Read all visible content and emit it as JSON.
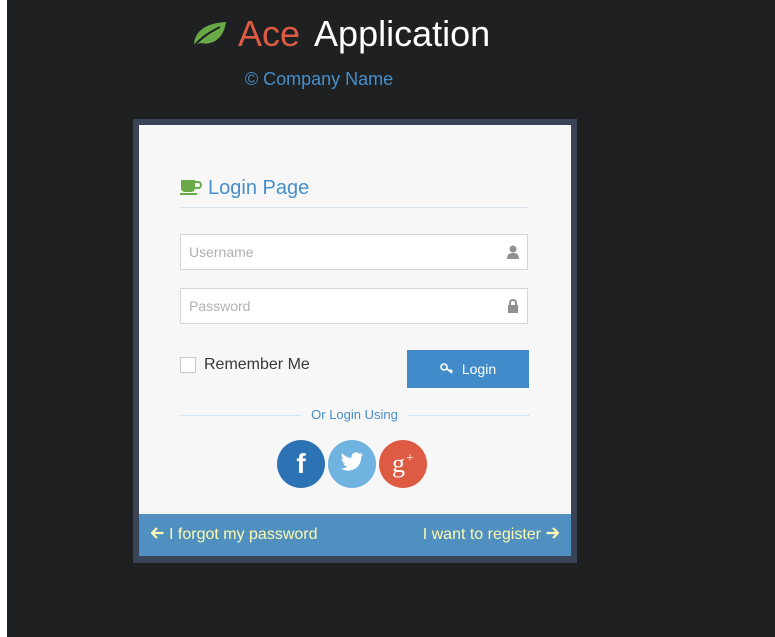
{
  "brand": {
    "ace": "Ace",
    "application": "Application",
    "company": "© Company Name"
  },
  "login": {
    "header": "Login Page",
    "username_placeholder": "Username",
    "password_placeholder": "Password",
    "remember_label": "Remember Me",
    "login_button": "Login",
    "or_text": "Or Login Using",
    "social": {
      "facebook": "f",
      "google": "g"
    }
  },
  "footer": {
    "forgot_link": "I forgot my password",
    "register_link": "I want to register"
  },
  "colors": {
    "background": "#1e2022",
    "accent": "#478fca",
    "brand_red": "#dd5a43",
    "login_button": "#428bca",
    "toolbar": "#5090c1",
    "toolbar_link": "#fef9b0"
  },
  "icons": [
    "leaf-icon",
    "coffee-icon",
    "user-icon",
    "lock-icon",
    "key-icon",
    "facebook-icon",
    "twitter-icon",
    "google-plus-icon",
    "arrow-left-icon",
    "arrow-right-icon"
  ]
}
